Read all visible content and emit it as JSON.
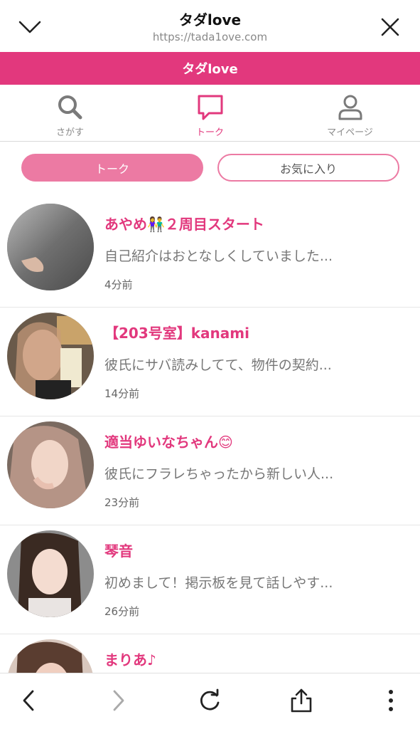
{
  "browser": {
    "title": "タダlove",
    "url": "https://tada1ove.com"
  },
  "site": {
    "header_title": "タダlove",
    "brand_color": "#e2387d"
  },
  "tabs": [
    {
      "label": "さがす",
      "icon": "search-icon",
      "active": false
    },
    {
      "label": "トーク",
      "icon": "chat-icon",
      "active": true
    },
    {
      "label": "マイページ",
      "icon": "user-icon",
      "active": false
    }
  ],
  "segment": {
    "talk_label": "トーク",
    "favorites_label": "お気に入り"
  },
  "talks": [
    {
      "name": "あやめ👫２周目スタート",
      "message": "自己紹介はおとなしくしていました...",
      "time": "4分前"
    },
    {
      "name": "【203号室】kanami",
      "message": "彼氏にサバ読みしてて、物件の契約...",
      "time": "14分前"
    },
    {
      "name": "適当ゆいなちゃん😊",
      "message": "彼氏にフラレちゃったから新しい人...",
      "time": "23分前"
    },
    {
      "name": "琴音",
      "message": "初めまして！掲示板を見て話しやす...",
      "time": "26分前"
    },
    {
      "name": "まりあ♪",
      "message": "",
      "time": ""
    }
  ]
}
